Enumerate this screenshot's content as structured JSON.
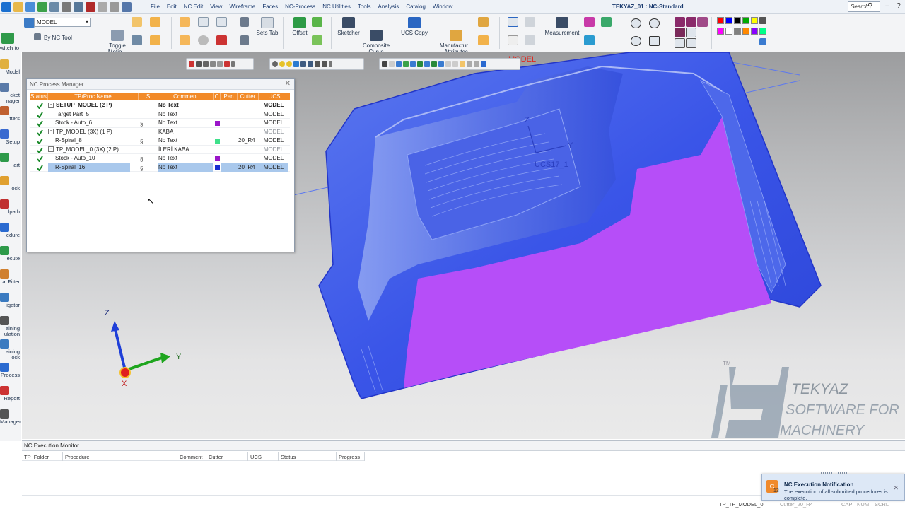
{
  "app": {
    "window_title": "TEKYAZ_01 : NC-Standard",
    "search_placeholder": "Search",
    "menu": [
      "File",
      "Edit",
      "NC Edit",
      "View",
      "Wireframe",
      "Faces",
      "NC-Process",
      "NC Utilities",
      "Tools",
      "Analysis",
      "Catalog",
      "Window"
    ]
  },
  "ribbon": {
    "mode_switch": "witch to\nD Mode",
    "model_combo": "MODEL",
    "by_nc_tool": "By NC Tool",
    "toggle_motion": "Toggle\nMotio...",
    "sets_tab": "Sets Tab",
    "offset": "Offset",
    "sketcher": "Sketcher",
    "composite_curve": "Composite\nCurve",
    "ucs_copy": "UCS Copy",
    "manufacturing_attributes": "Manufactur...\nAttributes",
    "measurement": "Measurement",
    "palette_colors": [
      "#ff0000",
      "#0000ff",
      "#000000",
      "#00aa00",
      "#ffff00",
      "#00ffff",
      "#ff00ff",
      "#ffffff",
      "#808080",
      "#ff8800",
      "#8800ff",
      "#00ff88"
    ]
  },
  "leftbar": [
    "Model",
    "cket\nnager",
    "tters",
    "Setup",
    "art",
    "ock",
    "lpath",
    "edure",
    "ecute",
    "al Filter",
    "igator",
    "aining\nulation",
    "aining\nock",
    "Process",
    "Report",
    "Manager"
  ],
  "process_manager": {
    "title": "NC Process Manager",
    "columns": [
      "Status",
      "TP/Proc Name",
      "S",
      "Comment",
      "C",
      "Pen",
      "Cutter",
      "UCS"
    ],
    "rows": [
      {
        "name": "SETUP_MODEL (2 P)",
        "expander": "-",
        "indent": 0,
        "bold": true,
        "s": "",
        "comment": "No Text",
        "color": "",
        "pen": "",
        "ucs": "MODEL",
        "dim": false,
        "selected": false
      },
      {
        "name": "Target Part_5",
        "expander": "",
        "indent": 1,
        "bold": false,
        "s": "",
        "comment": "No Text",
        "color": "",
        "pen": "",
        "ucs": "MODEL",
        "dim": false,
        "selected": false
      },
      {
        "name": "Stock - Auto_6",
        "expander": "",
        "indent": 1,
        "bold": false,
        "s": "link",
        "comment": "No Text",
        "color": "#9a16c9",
        "pen": "",
        "ucs": "MODEL",
        "dim": false,
        "selected": false
      },
      {
        "name": "TP_MODEL (3X) (1 P)",
        "expander": "-",
        "indent": 0,
        "bold": false,
        "s": "bulb",
        "comment": "KABA",
        "color": "",
        "pen": "",
        "ucs": "MODEL",
        "dim": true,
        "selected": false
      },
      {
        "name": "R-Spiral_8",
        "expander": "",
        "indent": 1,
        "bold": false,
        "s": "bulb+link",
        "comment": "No Text",
        "color": "#3ee08a",
        "pen": "20_R4",
        "ucs": "MODEL",
        "dim": false,
        "selected": false
      },
      {
        "name": "TP_MODEL_0 (3X) (2 P)",
        "expander": "-",
        "indent": 0,
        "bold": false,
        "s": "bulb",
        "comment": "İLERİ KABA",
        "color": "",
        "pen": "",
        "ucs": "MODEL",
        "dim": true,
        "selected": false
      },
      {
        "name": "Stock - Auto_10",
        "expander": "",
        "indent": 1,
        "bold": false,
        "s": "link",
        "comment": "No Text",
        "color": "#9a16c9",
        "pen": "",
        "ucs": "MODEL",
        "dim": false,
        "selected": false
      },
      {
        "name": "R-Spiral_16",
        "expander": "",
        "indent": 1,
        "bold": false,
        "s": "bulb+link",
        "comment": "No Text",
        "color": "#1a2fd0",
        "pen": "20_R4",
        "ucs": "MODEL",
        "dim": false,
        "selected": true
      }
    ]
  },
  "viewport": {
    "labels": {
      "axis_z": "Z",
      "axis_y": "Y",
      "axis_x": "X",
      "ucs_label": "UCS17_1",
      "model_label": "MODEL",
      "part_z": "Z",
      "part_y": "Y"
    },
    "watermark": {
      "tm": "TM",
      "line1": "TEKYAZ",
      "line2": "SOFTWARE FOR",
      "line3": "MACHINERY"
    }
  },
  "execution_monitor": {
    "title": "NC Execution Monitor",
    "columns": [
      "TP_Folder",
      "Procedure",
      "Comment",
      "Cutter",
      "UCS",
      "Status",
      "Progress"
    ]
  },
  "notification": {
    "title": "NC Execution Notification",
    "message": "The execution of all submitted procedures is complete.",
    "badge": "13"
  },
  "statusbar": {
    "tp": "TP_TP_MODEL_0",
    "cutter": "Cutter_20_R4",
    "flags": [
      "CAP",
      "NUM",
      "SCRL"
    ]
  }
}
